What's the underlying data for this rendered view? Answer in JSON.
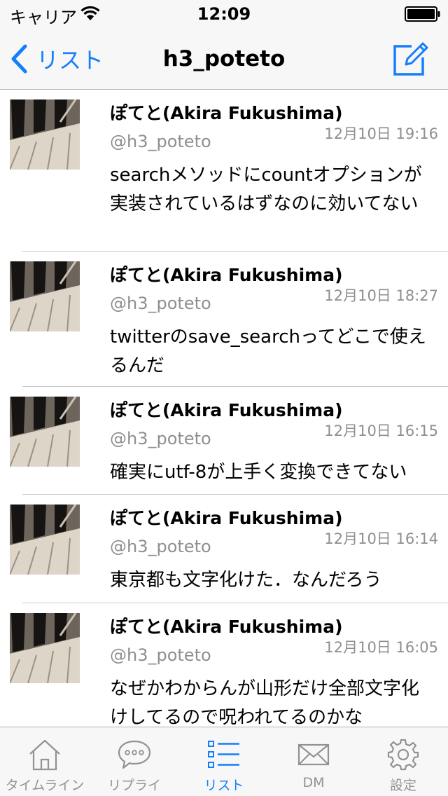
{
  "status_bar": {
    "carrier": "キャリア",
    "time": "12:09"
  },
  "nav": {
    "back_label": "リスト",
    "title": "h3_poteto"
  },
  "tweets": [
    {
      "name": "ぽてと(Akira Fukushima)",
      "handle": "@h3_poteto",
      "time": "12月10日 19:16",
      "text": "searchメソッドにcountオプションが実装されているはずなのに効いてない"
    },
    {
      "name": "ぽてと(Akira Fukushima)",
      "handle": "@h3_poteto",
      "time": "12月10日 18:27",
      "text": "twitterのsave_searchってどこで使えるんだ"
    },
    {
      "name": "ぽてと(Akira Fukushima)",
      "handle": "@h3_poteto",
      "time": "12月10日 16:15",
      "text": "確実にutf-8が上手く変換できてない"
    },
    {
      "name": "ぽてと(Akira Fukushima)",
      "handle": "@h3_poteto",
      "time": "12月10日 16:14",
      "text": "東京都も文字化けた．なんだろう"
    },
    {
      "name": "ぽてと(Akira Fukushima)",
      "handle": "@h3_poteto",
      "time": "12月10日 16:05",
      "text": "なぜかわからんが山形だけ全部文字化けしてるので呪われてるのかな"
    }
  ],
  "tab_bar": {
    "tabs": [
      {
        "label": "タイムライン",
        "icon": "home-icon",
        "active": false
      },
      {
        "label": "リプライ",
        "icon": "reply-bubble-icon",
        "active": false
      },
      {
        "label": "リスト",
        "icon": "list-icon",
        "active": true
      },
      {
        "label": "DM",
        "icon": "envelope-icon",
        "active": false
      },
      {
        "label": "設定",
        "icon": "gear-icon",
        "active": false
      }
    ]
  },
  "colors": {
    "accent": "#157efb",
    "secondary_text": "#8e8e93",
    "inactive_tab": "#929292"
  }
}
